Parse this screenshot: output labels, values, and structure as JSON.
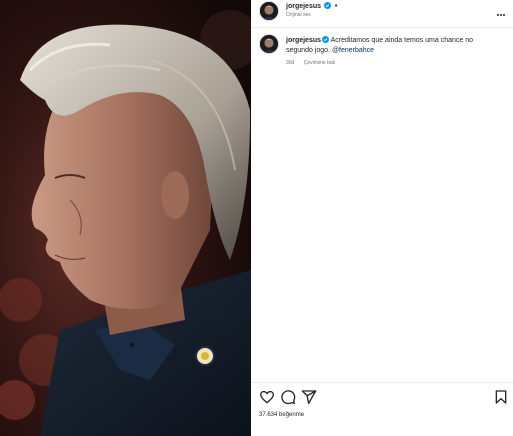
{
  "post": {
    "username": "jorgejesus",
    "separator": "•",
    "audio_label": "Orijinal ses"
  },
  "comment": {
    "username": "jorgejesus",
    "text": "Acreditamos que ainda temos uma chance no segundo jogo.",
    "mention": "@fenerbahce",
    "time": "30d",
    "translate_label": "Çevirisine bak"
  },
  "actions": {
    "like_icon": "heart-icon",
    "comment_icon": "comment-icon",
    "share_icon": "send-icon",
    "save_icon": "bookmark-icon"
  },
  "likes_text": "37.634 beğenme",
  "colors": {
    "verified": "#0095f6",
    "mention": "#00376b",
    "secondary_text": "#737373"
  }
}
